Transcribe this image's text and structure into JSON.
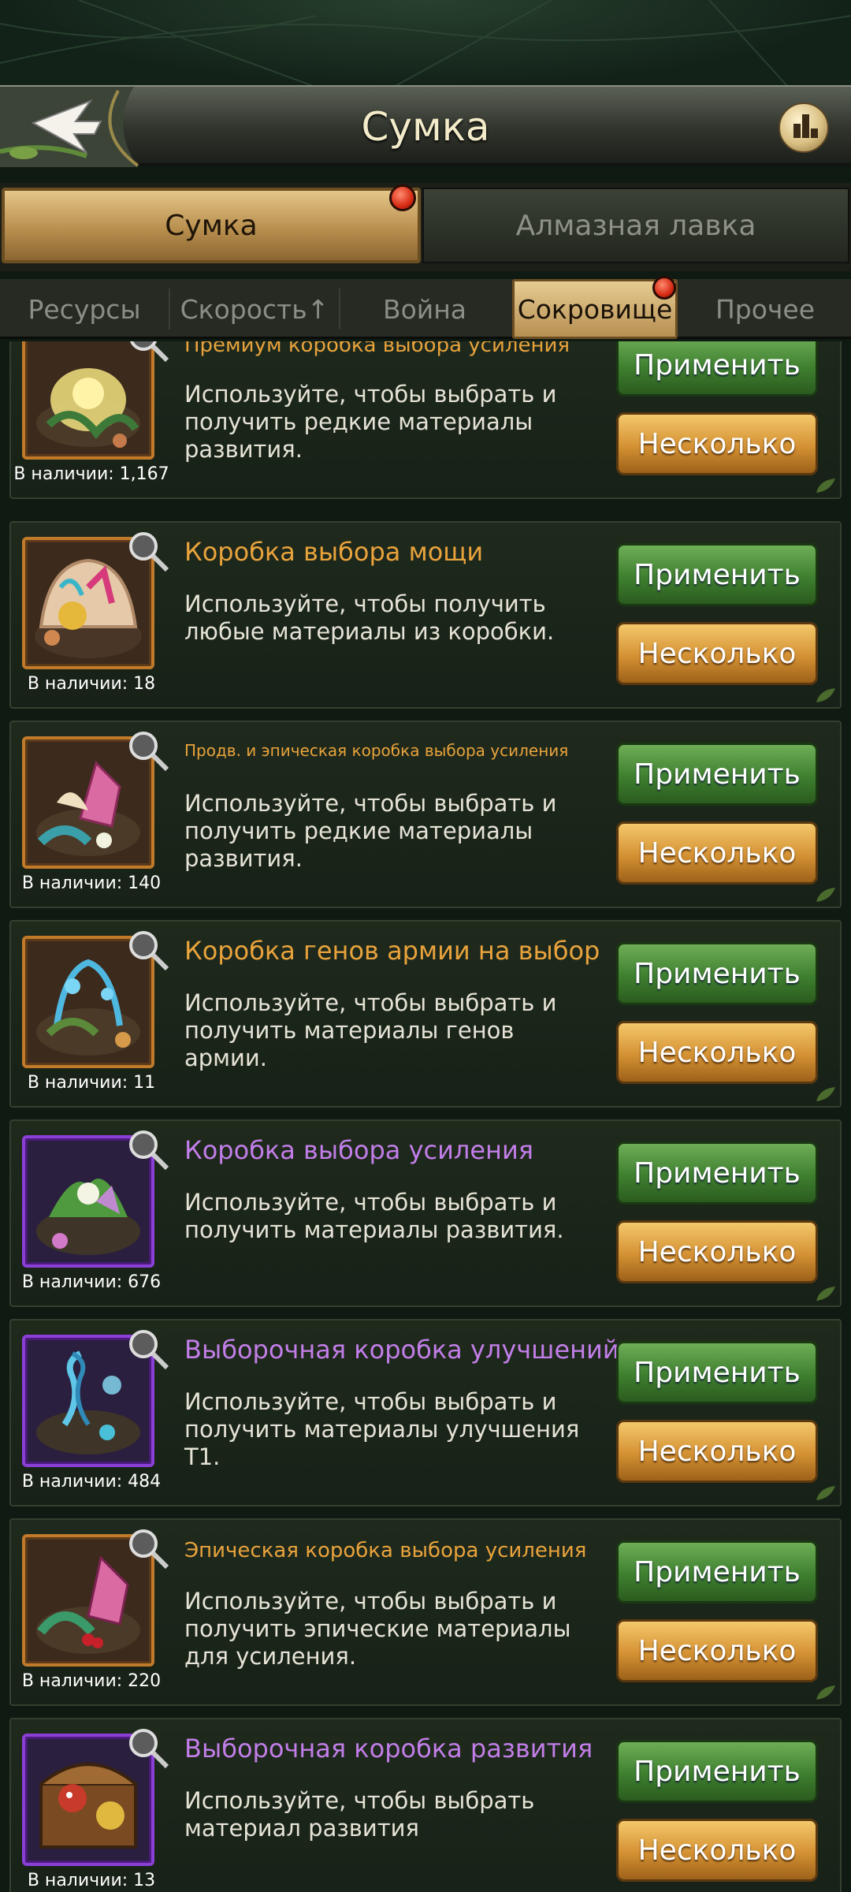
{
  "header": {
    "title": "Сумка"
  },
  "main_tabs": [
    {
      "label": "Сумка",
      "active": true,
      "badge": true
    },
    {
      "label": "Алмазная лавка",
      "active": false,
      "badge": false
    }
  ],
  "sub_tabs": [
    {
      "label": "Ресурсы",
      "active": false
    },
    {
      "label": "Скорость↑",
      "active": false
    },
    {
      "label": "Война",
      "active": false
    },
    {
      "label": "Сокровище",
      "active": true,
      "badge": true
    },
    {
      "label": "Прочее",
      "active": false
    }
  ],
  "buttons": {
    "apply": "Применить",
    "multiple": "Несколько"
  },
  "colors": {
    "orange_name": "#e9a33c",
    "purple_name": "#c27ee8",
    "apply_green": "#3e7f2f",
    "multi_gold": "#d49133",
    "badge_red": "#d62b14"
  },
  "items": [
    {
      "name": "Премиум коробка выбора усиления",
      "description": "Используйте, чтобы выбрать и получить редкие материалы развития.",
      "count": "В наличии: 1,167",
      "rarity": "orange",
      "icon": "nest-box-icon"
    },
    {
      "name": "Коробка выбора мощи",
      "description": "Используйте, чтобы получить любые материалы из коробки.",
      "count": "В наличии: 18",
      "rarity": "orange",
      "icon": "shell-box-icon"
    },
    {
      "name": "Продв. и эпическая коробка выбора усиления",
      "description": "Используйте, чтобы выбрать и получить редкие материалы развития.",
      "count": "В наличии: 140",
      "rarity": "orange",
      "icon": "crystal-nest-icon"
    },
    {
      "name": "Коробка генов армии на выбор",
      "description": "Используйте, чтобы выбрать и получить материалы генов армии.",
      "count": "В наличии: 11",
      "rarity": "orange",
      "icon": "gene-nest-icon"
    },
    {
      "name": "Коробка выбора усиления",
      "description": "Используйте, чтобы выбрать и получить материалы развития.",
      "count": "В наличии: 676",
      "rarity": "purple",
      "icon": "flower-nest-icon"
    },
    {
      "name": "Выборочная коробка улучшений",
      "description": "Используйте, чтобы выбрать и получить материалы улучшения T1.",
      "count": "В наличии: 484",
      "rarity": "purple",
      "icon": "dna-nest-icon"
    },
    {
      "name": "Эпическая коробка выбора усиления",
      "description": "Используйте, чтобы выбрать и получить эпические материалы для усиления.",
      "count": "В наличии: 220",
      "rarity": "orange",
      "icon": "ruby-nest-icon"
    },
    {
      "name": "Выборочная коробка развития",
      "description": "Используйте, чтобы выбрать материал развития",
      "count": "В наличии: 13",
      "rarity": "purple",
      "icon": "treasure-chest-icon"
    }
  ]
}
